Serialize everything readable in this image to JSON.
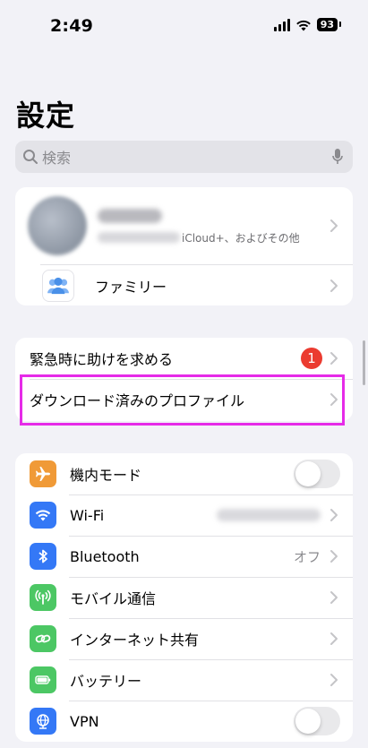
{
  "status_bar": {
    "time": "2:49",
    "battery": "93"
  },
  "title": "設定",
  "search": {
    "placeholder": "検索"
  },
  "account": {
    "subtitle": "iCloud+、およびその他"
  },
  "family": {
    "label": "ファミリー"
  },
  "group2": [
    {
      "label": "緊急時に助けを求める",
      "badge": "1"
    },
    {
      "label": "ダウンロード済みのプロファイル"
    }
  ],
  "settings": [
    {
      "label": "機内モード",
      "icon": "airplane-icon",
      "color": "#F09A37",
      "control": "toggle",
      "state": "off"
    },
    {
      "label": "Wi-Fi",
      "icon": "wifi-icon",
      "color": "#3478F6",
      "control": "chevron"
    },
    {
      "label": "Bluetooth",
      "icon": "bluetooth-icon",
      "color": "#3478F6",
      "value": "オフ",
      "control": "chevron"
    },
    {
      "label": "モバイル通信",
      "icon": "antenna-icon",
      "color": "#4CC764",
      "control": "chevron"
    },
    {
      "label": "インターネット共有",
      "icon": "link-icon",
      "color": "#4CC764",
      "control": "chevron"
    },
    {
      "label": "バッテリー",
      "icon": "battery-icon",
      "color": "#4CC764",
      "control": "chevron"
    },
    {
      "label": "VPN",
      "icon": "globe-icon",
      "color": "#3478F6",
      "control": "toggle",
      "state": "off"
    }
  ],
  "colors": {
    "background": "#F2F2F7",
    "highlight": "#E62BE8",
    "badge": "#EB3B30"
  }
}
